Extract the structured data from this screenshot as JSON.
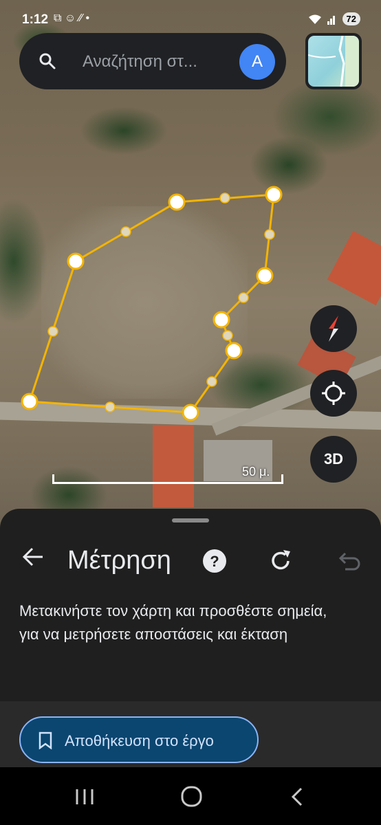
{
  "status": {
    "time": "1:12",
    "notification_icons": "⧉ ☺ ∕∕ •",
    "battery": "72"
  },
  "search": {
    "placeholder": "Αναζήτηση στ...",
    "avatar_letter": "A"
  },
  "map": {
    "scale_label": "50 μ.",
    "btn_3d": "3D",
    "polygon_color": "#f4b400"
  },
  "sheet": {
    "title": "Μέτρηση",
    "instructions": "Μετακινήστε τον χάρτη και προσθέστε σημεία, για να μετρήσετε αποστάσεις και έκταση",
    "save_label": "Αποθήκευση στο έργο"
  },
  "colors": {
    "sheet_bg": "#1f1f1f",
    "accent_blue": "#8ab4f8",
    "save_bg": "#0b4670"
  }
}
